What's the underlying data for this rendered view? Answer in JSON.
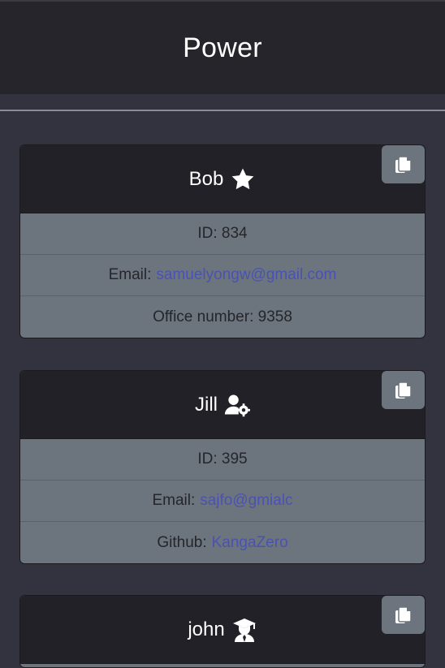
{
  "header": {
    "title": "Power"
  },
  "cards": [
    {
      "name": "Bob",
      "role_icon": "star-icon",
      "id_text": "ID: 834",
      "email_label": "Email:",
      "email": "samuelyongw@gmail.com",
      "extra_text": "Office number: 9358"
    },
    {
      "name": "Jill",
      "role_icon": "user-gear-icon",
      "id_text": "ID: 395",
      "email_label": "Email:",
      "email": "sajfo@gmialc",
      "extra_label": "Github:",
      "extra_link": "KangaZero"
    },
    {
      "name": "john",
      "role_icon": "graduate-icon"
    }
  ],
  "colors": {
    "header_bg": "#25252b",
    "page_bg": "#33333f",
    "card_head_bg": "#212127",
    "card_body_bg": "#6c757d",
    "link": "#4a52b0"
  }
}
